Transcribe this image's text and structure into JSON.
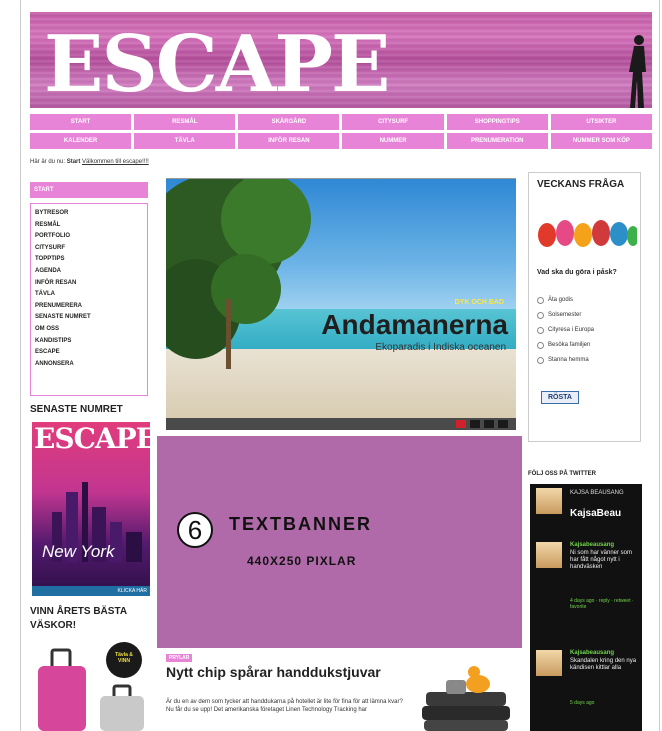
{
  "header": {
    "logo": "ESCAPE"
  },
  "nav": {
    "row1": [
      "Start",
      "Resmål",
      "Skärgård",
      "Citysurf",
      "Shoppingtips",
      "Utsikter"
    ],
    "row2": [
      "Kalender",
      "Tävla",
      "Inför resan",
      "Nummer",
      "Prenumeration",
      "Nummer som köp"
    ]
  },
  "breadcrumb": {
    "prefix": "Här är du nu:",
    "current": "Start",
    "link": "Välkommen till escape!!!!"
  },
  "sidebar": {
    "start": "Start",
    "items": [
      "Bytresor",
      "Resmål",
      "Portfolio",
      "Citysurf",
      "Topptips",
      "Agenda",
      "Inför resan",
      "Tävla",
      "Prenumerera",
      "Senaste numret",
      "Om oss",
      "Kandistips",
      "Escape",
      "Annonsera"
    ],
    "latest_title": "SENASTE NUMRET",
    "cover_logo": "ESCAPE",
    "cover_city": "New York",
    "cover_strip": "KLICKA HÄR",
    "vinn_title": "VINN ÅRETS BÄSTA VÄSKOR!",
    "vinn_badge": "Tävla & VINN"
  },
  "slideshow": {
    "kicker": "Dyk och bad",
    "title": "Andamanerna",
    "subtitle": "Ekoparadis i Indiska oceanen"
  },
  "textbanner": {
    "number": "6",
    "title": "TEXTBANNER",
    "size": "440X250 PIXLAR"
  },
  "article": {
    "tag": "Prylar",
    "title": "Nytt chip spårar handdukstjuvar",
    "body": "Är du en av dem som tycker att handdukarna på hotellet är lite för fina för att lämna kvar? Nu får du se upp! Det amerikanska företaget Linen Technology Tracking har"
  },
  "poll": {
    "title": "VECKANS FRÅGA",
    "question": "Vad ska du göra i påsk?",
    "options": [
      "Äta godis",
      "Solsemester",
      "Cityresa i Europa",
      "Besöka familjen",
      "Stanna hemma"
    ],
    "vote_label": "RÖSTA"
  },
  "twitter": {
    "title": "FÖLJ OSS PÅ TWITTER",
    "head_name": "KAJSA BEAUSANG",
    "head_handle": "KajsaBeau",
    "tweets": [
      {
        "user": "Kajsabeausang",
        "text": "Ni som har vänner som har fått något nytt i handväsken",
        "meta": "4 days ago · reply · retweet · favorite"
      },
      {
        "user": "Kajsabeausang",
        "text": "Skandalen kring den nya kändisen kittlar alla",
        "meta": "5 days ago"
      }
    ]
  }
}
